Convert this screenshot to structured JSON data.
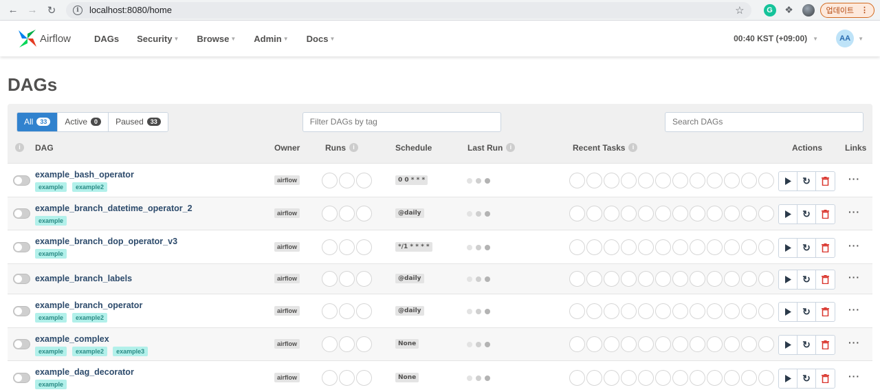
{
  "browser": {
    "url": "localhost:8080/home",
    "update_label": "업데이트",
    "update_dots": "⋮"
  },
  "navbar": {
    "logo_text": "Airflow",
    "items": [
      "DAGs",
      "Security",
      "Browse",
      "Admin",
      "Docs"
    ],
    "clock": "00:40 KST (+09:00)",
    "user_initials": "AA"
  },
  "page": {
    "title": "DAGs"
  },
  "filters": {
    "all_label": "All",
    "all_count": "33",
    "active_label": "Active",
    "active_count": "0",
    "paused_label": "Paused",
    "paused_count": "33",
    "tag_placeholder": "Filter DAGs by tag",
    "search_placeholder": "Search DAGs"
  },
  "columns": {
    "dag": "DAG",
    "owner": "Owner",
    "runs": "Runs",
    "schedule": "Schedule",
    "last_run": "Last Run",
    "recent_tasks": "Recent Tasks",
    "actions": "Actions",
    "links": "Links"
  },
  "dags": [
    {
      "name": "example_bash_operator",
      "tags": [
        "example",
        "example2"
      ],
      "owner": "airflow",
      "schedule": "0 0 * * *"
    },
    {
      "name": "example_branch_datetime_operator_2",
      "tags": [
        "example"
      ],
      "owner": "airflow",
      "schedule": "@daily"
    },
    {
      "name": "example_branch_dop_operator_v3",
      "tags": [
        "example"
      ],
      "owner": "airflow",
      "schedule": "*/1 * * * *"
    },
    {
      "name": "example_branch_labels",
      "tags": [],
      "owner": "airflow",
      "schedule": "@daily"
    },
    {
      "name": "example_branch_operator",
      "tags": [
        "example",
        "example2"
      ],
      "owner": "airflow",
      "schedule": "@daily"
    },
    {
      "name": "example_complex",
      "tags": [
        "example",
        "example2",
        "example3"
      ],
      "owner": "airflow",
      "schedule": "None"
    },
    {
      "name": "example_dag_decorator",
      "tags": [
        "example"
      ],
      "owner": "airflow",
      "schedule": "None"
    }
  ],
  "icons": {
    "trigger": "play-icon",
    "refresh": "refresh-icon",
    "delete": "trash-icon",
    "links": "more-icon"
  },
  "colors": {
    "accent": "#3182ce",
    "tag_bg": "#b2f0ea",
    "delete": "#d9332b"
  }
}
